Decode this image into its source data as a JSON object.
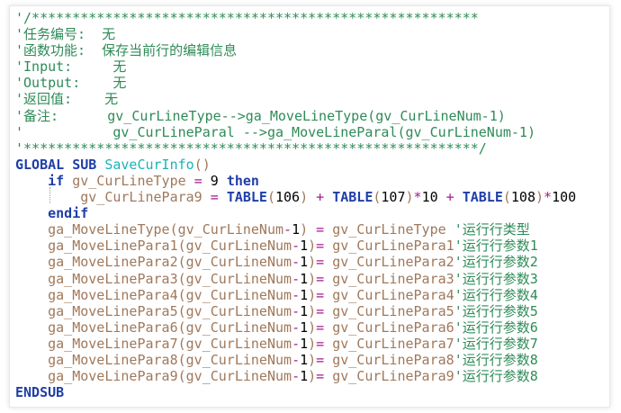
{
  "code_lines": [
    "'/*******************************************************",
    "'任务编号:  无",
    "'函数功能:  保存当前行的编辑信息",
    "'Input:     无",
    "'Output:    无",
    "'返回值:    无",
    "'备注:      gv_CurLineType-->ga_MoveLineType(gv_CurLineNum-1)",
    "'           gv_CurLineParal -->ga_MoveLineParal(gv_CurLineNum-1)",
    "'********************************************************/",
    "GLOBAL SUB SaveCurInfo()",
    "    if gv_CurLineType = 9 then",
    "        gv_CurLinePara9 = TABLE(106) + TABLE(107)*10 + TABLE(108)*100",
    "    endif",
    "    ga_MoveLineType(gv_CurLineNum-1) = gv_CurLineType '运行行类型",
    "    ga_MoveLinePara1(gv_CurLineNum-1)= gv_CurLinePara1'运行行参数1",
    "    ga_MoveLinePara2(gv_CurLineNum-1)= gv_CurLinePara2'运行行参数2",
    "    ga_MoveLinePara3(gv_CurLineNum-1)= gv_CurLinePara3'运行行参数3",
    "    ga_MoveLinePara4(gv_CurLineNum-1)= gv_CurLinePara4'运行行参数4",
    "    ga_MoveLinePara5(gv_CurLineNum-1)= gv_CurLinePara5'运行行参数5",
    "    ga_MoveLinePara6(gv_CurLineNum-1)= gv_CurLinePara6'运行行参数6",
    "    ga_MoveLinePara7(gv_CurLineNum-1)= gv_CurLinePara7'运行行参数7",
    "    ga_MoveLinePara8(gv_CurLineNum-1)= gv_CurLinePara8'运行行参数8",
    "    ga_MoveLinePara9(gv_CurLineNum-1)= gv_CurLinePara9'运行行参数8",
    "ENDSUB"
  ],
  "colors": {
    "comment": "#2e8b57",
    "keyword": "#1f3ea8",
    "function_name": "#1ab3b8",
    "identifier": "#a0785a",
    "operator": "#a31a8c"
  }
}
